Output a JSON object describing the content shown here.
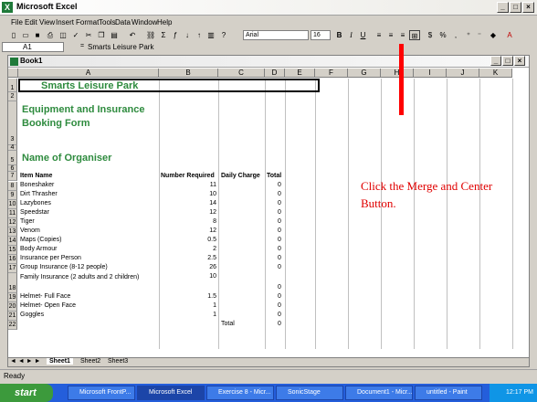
{
  "window": {
    "title": "Microsoft Excel"
  },
  "menu": [
    "File",
    "Edit",
    "View",
    "Insert",
    "Format",
    "Tools",
    "Data",
    "Window",
    "Help"
  ],
  "toolbar": {
    "font_name": "Arial",
    "font_size": "16",
    "bold": "B",
    "italic": "I",
    "underline": "U"
  },
  "formula_bar": {
    "name_box": "A1",
    "formula": "Smarts Leisure Park"
  },
  "workbook": {
    "title": "Book1"
  },
  "columns": [
    "A",
    "B",
    "C",
    "D",
    "E",
    "F",
    "G",
    "H",
    "I",
    "J",
    "K"
  ],
  "sheet": {
    "title": "Smarts Leisure Park",
    "subtitle": "Equipment and Insurance Booking Form",
    "organiser_label": "Name of Organiser",
    "headers": [
      "Item Name",
      "Number Required",
      "Daily Charge",
      "Total"
    ],
    "rows": [
      {
        "num": "8",
        "item": "Boneshaker",
        "qty": "11",
        "total": "0"
      },
      {
        "num": "9",
        "item": "Dirt Thrasher",
        "qty": "10",
        "total": "0"
      },
      {
        "num": "10",
        "item": "Lazybones",
        "qty": "14",
        "total": "0"
      },
      {
        "num": "11",
        "item": "Speedstar",
        "qty": "12",
        "total": "0"
      },
      {
        "num": "12",
        "item": "Tiger",
        "qty": "8",
        "total": "0"
      },
      {
        "num": "13",
        "item": "Venom",
        "qty": "12",
        "total": "0"
      },
      {
        "num": "14",
        "item": "Maps (Copies)",
        "qty": "0.5",
        "total": "0"
      },
      {
        "num": "15",
        "item": "Body Armour",
        "qty": "2",
        "total": "0"
      },
      {
        "num": "16",
        "item": "Insurance per Person",
        "qty": "2.5",
        "total": "0"
      },
      {
        "num": "17",
        "item": "Group Insurance (8-12 people)",
        "qty": "26",
        "total": "0"
      },
      {
        "num": "18",
        "item": "Family Insurance (2 adults and 2 children)",
        "qty": "10",
        "total": "0"
      },
      {
        "num": "19",
        "item": "Helmet- Full Face",
        "qty": "1.5",
        "total": "0"
      },
      {
        "num": "20",
        "item": "Helmet- Open Face",
        "qty": "1",
        "total": "0"
      },
      {
        "num": "21",
        "item": "Goggles",
        "qty": "1",
        "total": "0"
      }
    ],
    "total_label": "Total",
    "grand_total": "0"
  },
  "annotation": "Click the Merge and Center Button.",
  "sheet_tabs": [
    "Sheet1",
    "Sheet2",
    "Sheet3"
  ],
  "status": "Ready",
  "taskbar": {
    "start": "start",
    "tasks": [
      "Microsoft FrontP...",
      "Microsoft Excel",
      "Exercise 8 - Micr...",
      "SonicStage",
      "Document1 - Micr...",
      "untitled - Paint"
    ],
    "clock": "12:17 PM"
  },
  "colors": {
    "title_green": "#2e8b3e",
    "annotation_red": "#e00000"
  }
}
